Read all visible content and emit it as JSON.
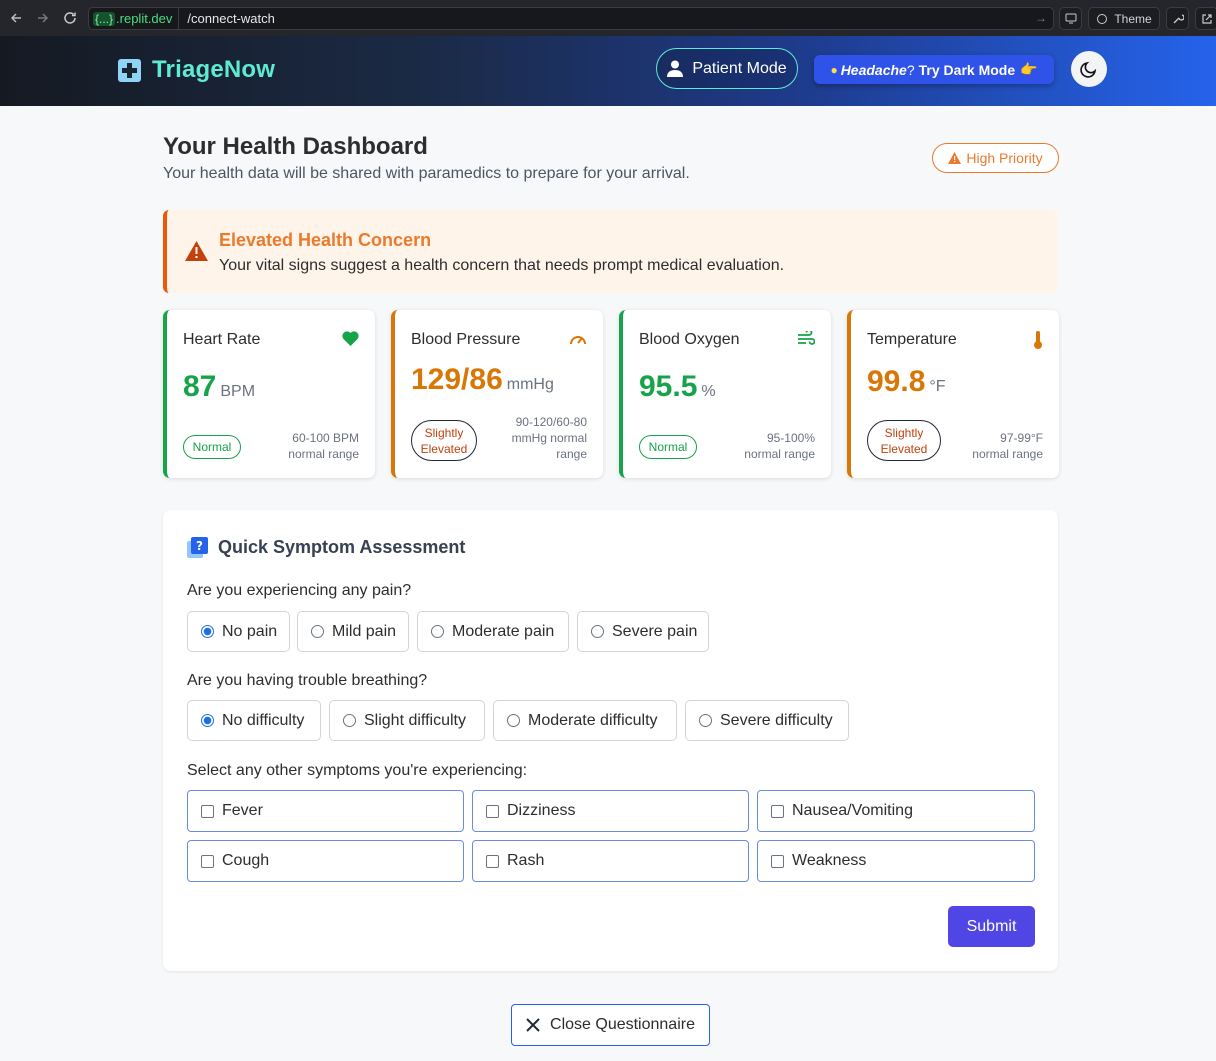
{
  "browser": {
    "domain_tag": "{...}",
    "domain": ".replit.dev",
    "path": "/connect-watch",
    "theme_label": "Theme"
  },
  "header": {
    "app_name": "TriageNow",
    "patient_mode_label": "Patient Mode",
    "promo_italic": "Headache",
    "promo_question": "?",
    "promo_action": "Try Dark Mode",
    "promo_emoji": "👉"
  },
  "dashboard": {
    "title": "Your Health Dashboard",
    "subtitle": "Your health data will be shared with paramedics to prepare for your arrival.",
    "priority_label": "High Priority"
  },
  "alert": {
    "title": "Elevated Health Concern",
    "description": "Your vital signs suggest a health concern that needs prompt medical evaluation."
  },
  "vitals": [
    {
      "label": "Heart Rate",
      "value": "87",
      "unit": "BPM",
      "status": "Normal",
      "range_line1": "60-100 BPM",
      "range_line2": "normal range",
      "icon": "heart-icon",
      "color": "#16a34a"
    },
    {
      "label": "Blood Pressure",
      "value": "129/86",
      "unit": "mmHg",
      "status_line1": "Slightly",
      "status_line2": "Elevated",
      "range_line1": "90-120/60-80",
      "range_line2": "mmHg normal",
      "range_line3": "range",
      "icon": "gauge-icon",
      "color": "#d97706"
    },
    {
      "label": "Blood Oxygen",
      "value": "95.5",
      "unit": "%",
      "status": "Normal",
      "range_line1": "95-100%",
      "range_line2": "normal range",
      "icon": "wind-icon",
      "color": "#16a34a"
    },
    {
      "label": "Temperature",
      "value": "99.8",
      "unit": "°F",
      "status_line1": "Slightly",
      "status_line2": "Elevated",
      "range_line1": "97-99°F",
      "range_line2": "normal range",
      "icon": "thermometer-icon",
      "color": "#d97706"
    }
  ],
  "assessment": {
    "title": "Quick Symptom Assessment",
    "pain_question": "Are you experiencing any pain?",
    "pain_options": [
      "No pain",
      "Mild pain",
      "Moderate pain",
      "Severe pain"
    ],
    "pain_selected": "No pain",
    "breathing_question": "Are you having trouble breathing?",
    "breathing_options": [
      "No difficulty",
      "Slight difficulty",
      "Moderate difficulty",
      "Severe difficulty"
    ],
    "breathing_selected": "No difficulty",
    "symptoms_question": "Select any other symptoms you're experiencing:",
    "symptoms": [
      "Fever",
      "Dizziness",
      "Nausea/Vomiting",
      "Cough",
      "Rash",
      "Weakness"
    ],
    "submit_label": "Submit"
  },
  "close_label": "Close Questionnaire"
}
